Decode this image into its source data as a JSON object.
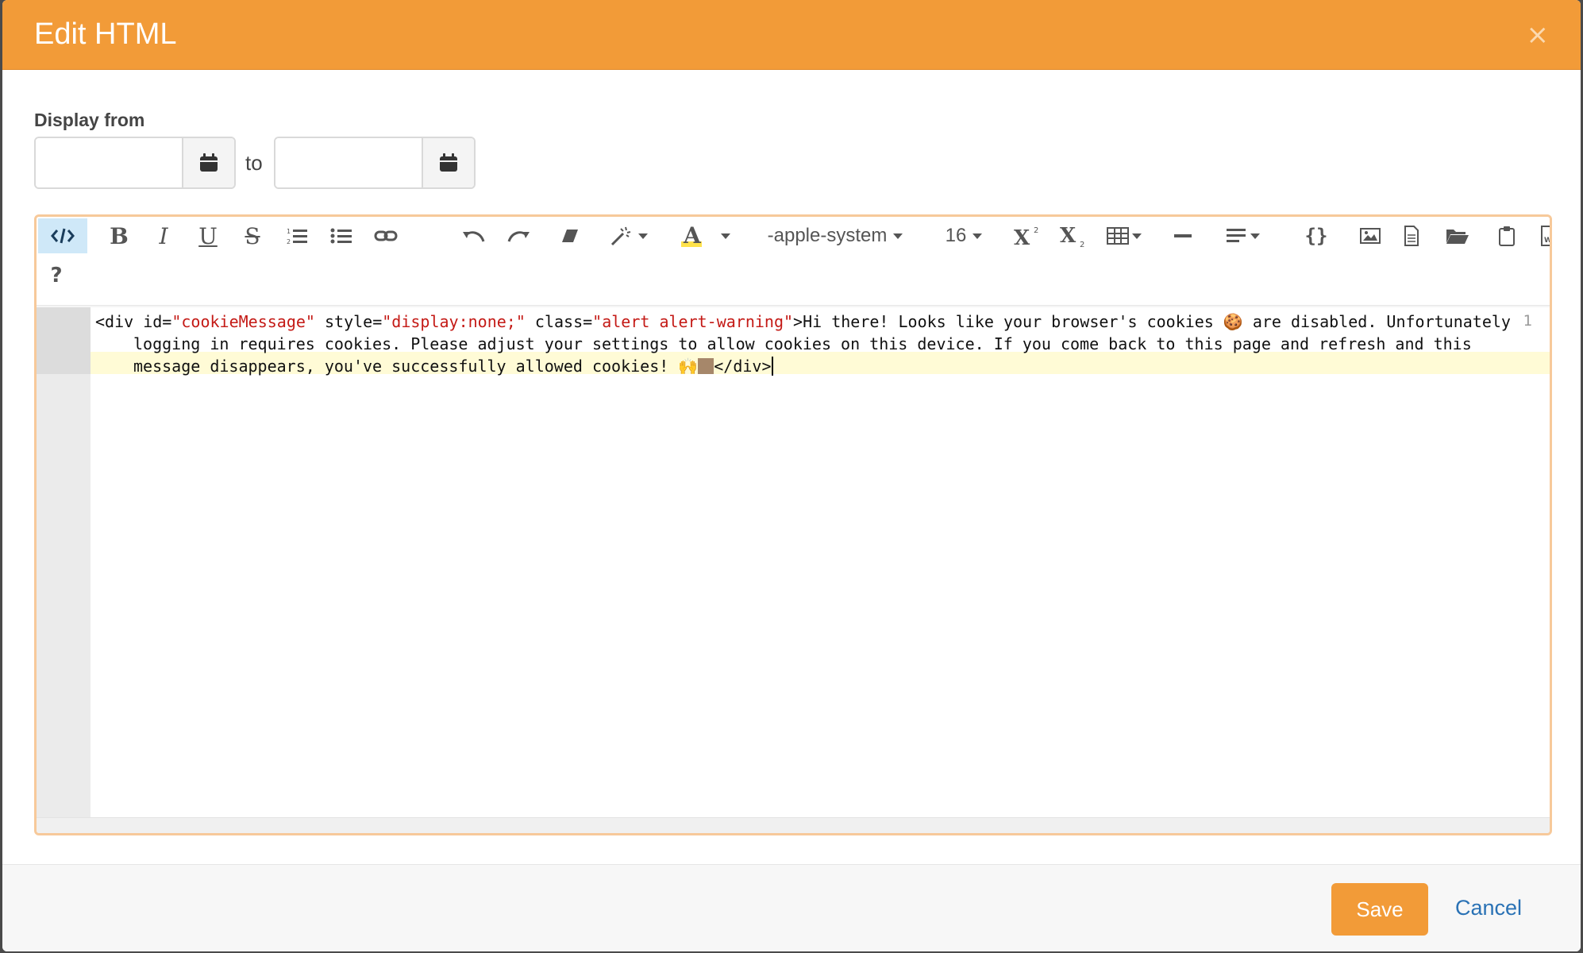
{
  "modal": {
    "title": "Edit HTML",
    "close_glyph": "×"
  },
  "display": {
    "label": "Display from",
    "to_label": "to",
    "from_value": "",
    "to_value": ""
  },
  "toolbar": {
    "font_family": "-apple-system",
    "font_size": "16",
    "code_view_icon": "code-view-icon",
    "icons": [
      "code-view-icon",
      "bold-icon",
      "italic-icon",
      "underline-icon",
      "strikethrough-icon",
      "ordered-list-icon",
      "unordered-list-icon",
      "link-icon",
      "undo-icon",
      "redo-icon",
      "eraser-icon",
      "magic-wand-icon",
      "text-color-icon",
      "superscript-icon",
      "subscript-icon",
      "table-icon",
      "horizontal-rule-icon",
      "align-icon",
      "code-block-icon",
      "image-icon",
      "document-icon",
      "folder-icon",
      "clipboard-icon",
      "word-doc-icon",
      "help-icon"
    ],
    "help_label": "?"
  },
  "editor": {
    "line_number": "1",
    "code": {
      "t1": "<div id=",
      "s1": "\"cookieMessage\"",
      "t2": " style=",
      "s2": "\"display:none;\"",
      "t3": " class=",
      "s3": "\"alert alert-warning\"",
      "t4": ">Hi there! Looks like your browser's cookies 🍪 are disabled. Unfortunately",
      "line2": "logging in requires cookies. Please adjust your settings to allow cookies on this device. If you come back to this page and refresh and this",
      "line3a": "message disappears, you've successfully allowed cookies! 🙌",
      "line3b": "</div>"
    }
  },
  "footer": {
    "save_label": "Save",
    "cancel_label": "Cancel"
  },
  "colors": {
    "header": "#f29b38",
    "code_string": "#c41a16",
    "link": "#2a72b5",
    "active_line": "#fffbd6"
  }
}
